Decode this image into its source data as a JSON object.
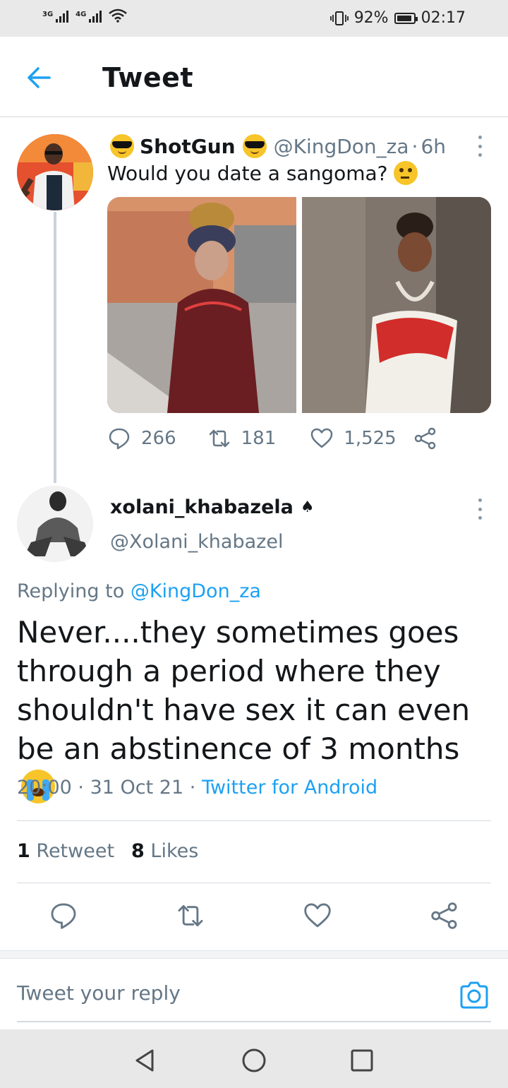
{
  "status_bar": {
    "network1": "3G",
    "network2": "4G",
    "battery_percent_label": "92%",
    "battery_level": 0.92,
    "time": "02:17"
  },
  "header": {
    "title": "Tweet"
  },
  "original_tweet": {
    "display_name": "ShotGun",
    "handle": "@KingDon_za",
    "separator": "·",
    "time_ago": "6h",
    "text": "Would you date a sangoma?",
    "replies_count": "266",
    "retweets_count": "181",
    "likes_count": "1,525"
  },
  "reply_tweet": {
    "display_name": "xolani_khabazela",
    "handle": "@Xolani_khabazel",
    "replying_prefix": "Replying to",
    "replying_to": "@KingDon_za",
    "text": "Never....they sometimes goes through a period where they shouldn't have sex it can even be an abstinence of 3 months",
    "time": "20:00",
    "separator1": "·",
    "date": "31 Oct 21",
    "separator2": "·",
    "source": "Twitter for Android",
    "retweets_count": "1",
    "retweets_label": "Retweet",
    "likes_count": "8",
    "likes_label": "Likes"
  },
  "reply_box": {
    "placeholder": "Tweet your reply"
  },
  "icons": {
    "back": "arrow-left-icon",
    "more": "more-vertical-icon",
    "reply": "speech-bubble-icon",
    "retweet": "retweet-icon",
    "like": "heart-icon",
    "share": "share-icon",
    "camera": "camera-icon"
  },
  "colors": {
    "accent": "#1da1f2",
    "muted": "#657786",
    "text": "#14171a"
  }
}
